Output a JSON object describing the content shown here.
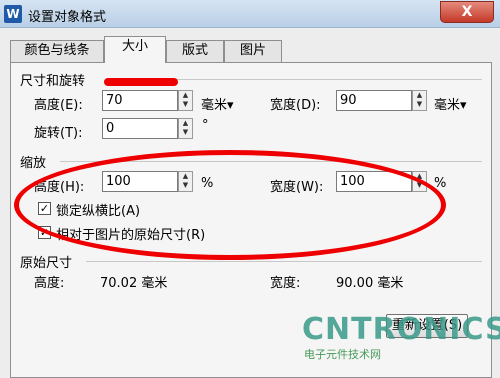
{
  "window": {
    "title": "设置对象格式",
    "close": "X"
  },
  "tabs": [
    "颜色与线条",
    "大小",
    "版式",
    "图片"
  ],
  "size_rotate": {
    "section": "尺寸和旋转",
    "height_label": "高度(E):",
    "height_value": "70",
    "height_unit": "毫米▾",
    "width_label": "宽度(D):",
    "width_value": "90",
    "width_unit": "毫米▾",
    "rotate_label": "旋转(T):",
    "rotate_value": "0",
    "rotate_unit": "°"
  },
  "scale": {
    "section": "缩放",
    "height_label": "高度(H):",
    "height_value": "100",
    "height_unit": "%",
    "width_label": "宽度(W):",
    "width_value": "100",
    "width_unit": "%",
    "lock_label": "锁定纵横比(A)",
    "lock_checked": true,
    "relative_label": "相对于图片的原始尺寸(R)",
    "relative_checked": true
  },
  "original": {
    "section": "原始尺寸",
    "height_label": "高度:",
    "height_value": "70.02 毫米",
    "width_label": "宽度:",
    "width_value": "90.00 毫米"
  },
  "reset_button": "重新设置(S)",
  "watermark": {
    "logo": "CNTRONICS",
    "sub": "电子元件技术网"
  },
  "colors": {
    "annotation": "#e00000"
  }
}
